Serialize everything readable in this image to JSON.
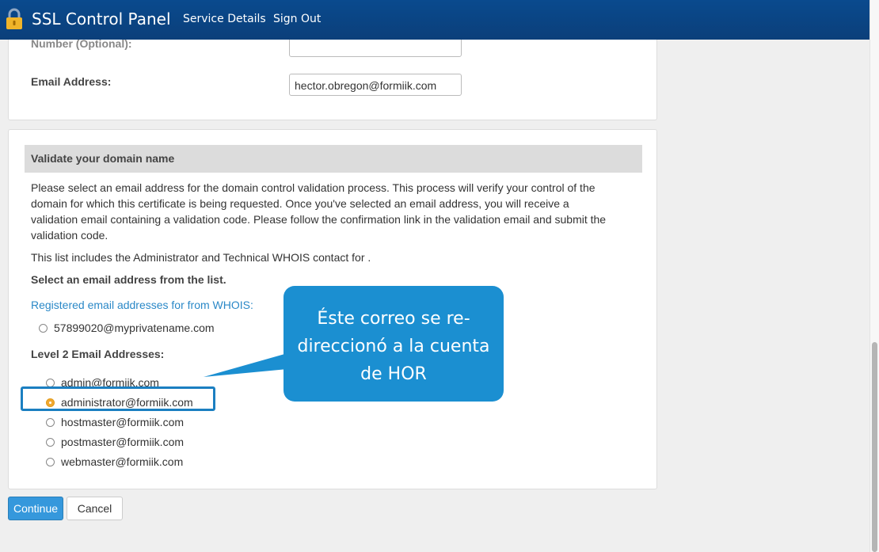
{
  "header": {
    "title": "SSL Control Panel",
    "nav": [
      "Service Details",
      "Sign Out"
    ]
  },
  "contact_form": {
    "phone_label_partial": "Number (Optional):",
    "email_label": "Email Address:",
    "email_value": "hector.obregon@formiik.com"
  },
  "validation": {
    "heading": "Validate your domain name",
    "description": "Please select an email address for the domain control validation process. This process will verify your control of the domain for which this certificate is being requested. Once you've selected an email address, you will receive a validation email containing a validation code. Please follow the confirmation link in the validation email and submit the validation code.",
    "whois_note": "This list includes the Administrator and Technical WHOIS contact for .",
    "select_prompt": "Select an email address from the list.",
    "whois_heading": "Registered email addresses for from WHOIS:",
    "whois_options": [
      "57899020@myprivatename.com"
    ],
    "level2_heading": "Level 2 Email Addresses:",
    "level2_options": [
      "admin@formiik.com",
      "administrator@formiik.com",
      "hostmaster@formiik.com",
      "postmaster@formiik.com",
      "webmaster@formiik.com"
    ],
    "selected": "administrator@formiik.com"
  },
  "callout": {
    "lines": [
      "Éste correo se re-",
      "direccionó a la cuenta",
      "de HOR"
    ]
  },
  "buttons": {
    "continue": "Continue",
    "cancel": "Cancel"
  },
  "colors": {
    "header": "#0b4684",
    "accent": "#1b8fd1",
    "primary_button": "#3598dc",
    "selected_radio": "#f0a830"
  }
}
